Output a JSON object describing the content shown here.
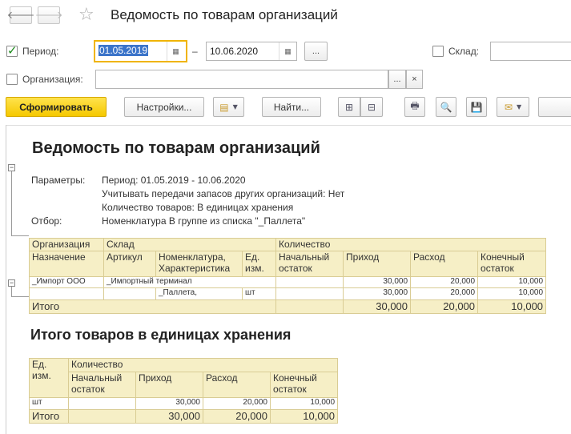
{
  "window": {
    "title": "Ведомость по товарам организаций"
  },
  "filters": {
    "period_label": "Период:",
    "period_checked": true,
    "period_from": "01.05.2019",
    "period_dash": "–",
    "period_to": "10.06.2020",
    "more_label": "...",
    "warehouse_label": "Склад:",
    "warehouse_checked": false,
    "warehouse_value": "",
    "organization_label": "Организация:",
    "organization_checked": false,
    "organization_value": "",
    "clear_label": "×"
  },
  "toolbar": {
    "generate_label": "Сформировать",
    "settings_label": "Настройки...",
    "find_label": "Найти...",
    "icons": [
      "variant-icon",
      "expand-groups-icon",
      "collapse-groups-icon",
      "print-icon",
      "preview-icon",
      "save-icon",
      "mail-icon"
    ]
  },
  "report": {
    "title": "Ведомость по товарам организаций",
    "params_label": "Параметры:",
    "params": [
      "Период: 01.05.2019 - 10.06.2020",
      "Учитывать передачи запасов других организаций: Нет",
      "Количество товаров: В единицах хранения"
    ],
    "filter_label": "Отбор:",
    "filter_value": "Номенклатура В группе из списка \"_Паллета\"",
    "table1": {
      "header1": [
        "Организация",
        "Склад",
        "",
        "",
        "Количество"
      ],
      "header2": [
        "Назначение",
        "Артикул",
        "Номенклатура,\nХарактеристика",
        "Ед.\nизм.",
        "Начальный\nостаток",
        "Приход",
        "Расход",
        "Конечный\nостаток"
      ],
      "rows": [
        [
          "_Импорт ООО",
          "_Импортный терминал",
          "",
          "",
          "",
          "30,000",
          "20,000",
          "10,000"
        ],
        [
          "",
          "",
          "_Паллета,",
          "шт",
          "",
          "30,000",
          "20,000",
          "10,000"
        ]
      ],
      "total": [
        "Итого",
        "",
        "",
        "",
        "",
        "30,000",
        "20,000",
        "10,000"
      ]
    },
    "subtitle": "Итого товаров в единицах хранения",
    "table2": {
      "header1": [
        "Ед.\nизм.",
        "Количество"
      ],
      "header2": [
        "Начальный\nостаток",
        "Приход",
        "Расход",
        "Конечный\nостаток"
      ],
      "rows": [
        [
          "шт",
          "",
          "30,000",
          "20,000",
          "10,000"
        ]
      ],
      "total": [
        "Итого",
        "",
        "30,000",
        "20,000",
        "10,000"
      ]
    }
  },
  "colors": {
    "accent": "#f5c800",
    "header_bg": "#f6efc6",
    "grid": "#d9cc94",
    "selection": "#3b74c9"
  }
}
